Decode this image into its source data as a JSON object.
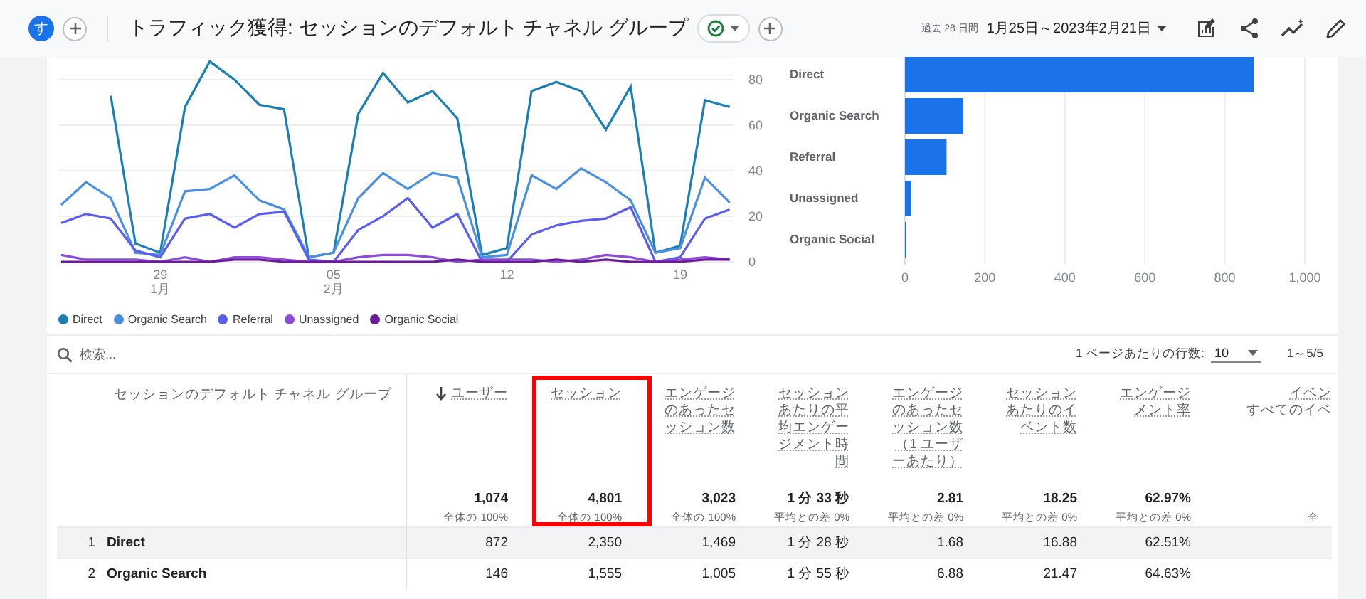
{
  "header": {
    "avatar": "す",
    "title": "トラフィック獲得: セッションのデフォルト チャネル グループ",
    "period_label": "過去 28 日間",
    "date_range": "1月25日～2023年2月21日"
  },
  "line_chart": {
    "chart_data": {
      "type": "line",
      "grid": true,
      "categories": [
        null,
        null,
        null,
        null,
        "29 1月",
        null,
        null,
        null,
        null,
        null,
        null,
        "05 2月",
        null,
        null,
        null,
        null,
        null,
        null,
        "12",
        null,
        null,
        null,
        null,
        null,
        null,
        "19",
        null,
        null
      ],
      "yticks": [
        0,
        20,
        40,
        60,
        80
      ],
      "ylim": [
        0,
        90
      ],
      "series": [
        {
          "name": "Direct",
          "color": "#1a7fb5",
          "values": [
            null,
            null,
            73,
            8,
            4,
            68,
            88,
            80,
            69,
            67,
            2,
            4,
            65,
            83,
            70,
            75,
            63,
            3,
            6,
            75,
            79,
            75,
            58,
            77,
            4,
            7,
            71,
            68
          ]
        },
        {
          "name": "Organic Search",
          "color": "#4a90e2",
          "values": [
            25,
            35,
            28,
            4,
            3,
            31,
            32,
            38,
            27,
            23,
            2,
            4,
            28,
            39,
            32,
            39,
            37,
            2,
            3,
            38,
            32,
            41,
            35,
            27,
            4,
            6,
            37,
            26
          ]
        },
        {
          "name": "Referral",
          "color": "#5b5cf0",
          "values": [
            17,
            21,
            19,
            5,
            2,
            19,
            21,
            15,
            21,
            22,
            1,
            0,
            14,
            20,
            28,
            15,
            21,
            0,
            0,
            12,
            16,
            18,
            19,
            24,
            0,
            2,
            19,
            23
          ]
        },
        {
          "name": "Unassigned",
          "color": "#8e4ad8",
          "values": [
            3,
            1,
            1,
            1,
            0,
            2,
            0,
            2,
            2,
            1,
            0,
            0,
            2,
            3,
            3,
            2,
            0,
            1,
            1,
            1,
            0,
            1,
            3,
            2,
            0,
            1,
            2,
            1
          ]
        },
        {
          "name": "Organic Social",
          "color": "#6a1b9a",
          "values": [
            0,
            0,
            0,
            0,
            0,
            0,
            0,
            1,
            1,
            0,
            0,
            0,
            0,
            0,
            0,
            0,
            1,
            0,
            0,
            0,
            1,
            0,
            1,
            0,
            0,
            0,
            1,
            1
          ]
        }
      ]
    }
  },
  "bar_chart": {
    "chart_data": {
      "type": "bar",
      "orientation": "horizontal",
      "grid": true,
      "categories": [
        "Direct",
        "Organic Search",
        "Referral",
        "Unassigned",
        "Organic Social"
      ],
      "values": [
        872,
        146,
        104,
        15,
        3
      ],
      "xlim": [
        0,
        1000
      ],
      "xticks": [
        0,
        200,
        400,
        600,
        800,
        {
          "value": 1000,
          "label": "1,000"
        }
      ]
    }
  },
  "search": {
    "placeholder": "検索..."
  },
  "pagination": {
    "rows_label": "1 ページあたりの行数:",
    "rows_value": "10",
    "range": "1～5/5"
  },
  "table": {
    "dimension": "セッションのデフォルト チャネル グループ",
    "columns": [
      {
        "title": "ユーザー",
        "sorted": true,
        "highlighted": false,
        "total": "1,074",
        "total_note": "全体の 100%"
      },
      {
        "title": "セッション",
        "sorted": false,
        "highlighted": true,
        "total": "4,801",
        "total_note": "全体の 100%"
      },
      {
        "title": "エンゲージのあったセッション数",
        "sorted": false,
        "highlighted": false,
        "total": "3,023",
        "total_note": "全体の 100%"
      },
      {
        "title": "セッションあたりの平均エンゲージメント時間",
        "sorted": false,
        "highlighted": false,
        "total": "1 分 33 秒",
        "total_note": "平均との差 0%"
      },
      {
        "title": "エンゲージのあったセッション数（1 ユーザーあたり）",
        "sorted": false,
        "highlighted": false,
        "total": "2.81",
        "total_note": "平均との差 0%"
      },
      {
        "title": "セッションあたりのイベント数",
        "sorted": false,
        "highlighted": false,
        "total": "18.25",
        "total_note": "平均との差 0%"
      },
      {
        "title": "エンゲージメント率",
        "sorted": false,
        "highlighted": false,
        "total": "62.97%",
        "total_note": "平均との差 0%"
      },
      {
        "title": "イベン",
        "subtitle": "すべてのイベ",
        "sorted": false,
        "highlighted": false,
        "total_note": "全"
      }
    ],
    "rows": [
      {
        "index": "1",
        "name": "Direct",
        "hovered": true,
        "cells": [
          "872",
          "2,350",
          "1,469",
          "1 分 28 秒",
          "1.68",
          "16.88",
          "62.51%"
        ]
      },
      {
        "index": "2",
        "name": "Organic Search",
        "hovered": false,
        "cells": [
          "146",
          "1,555",
          "1,005",
          "1 分 55 秒",
          "6.88",
          "21.47",
          "64.63%"
        ]
      }
    ]
  }
}
